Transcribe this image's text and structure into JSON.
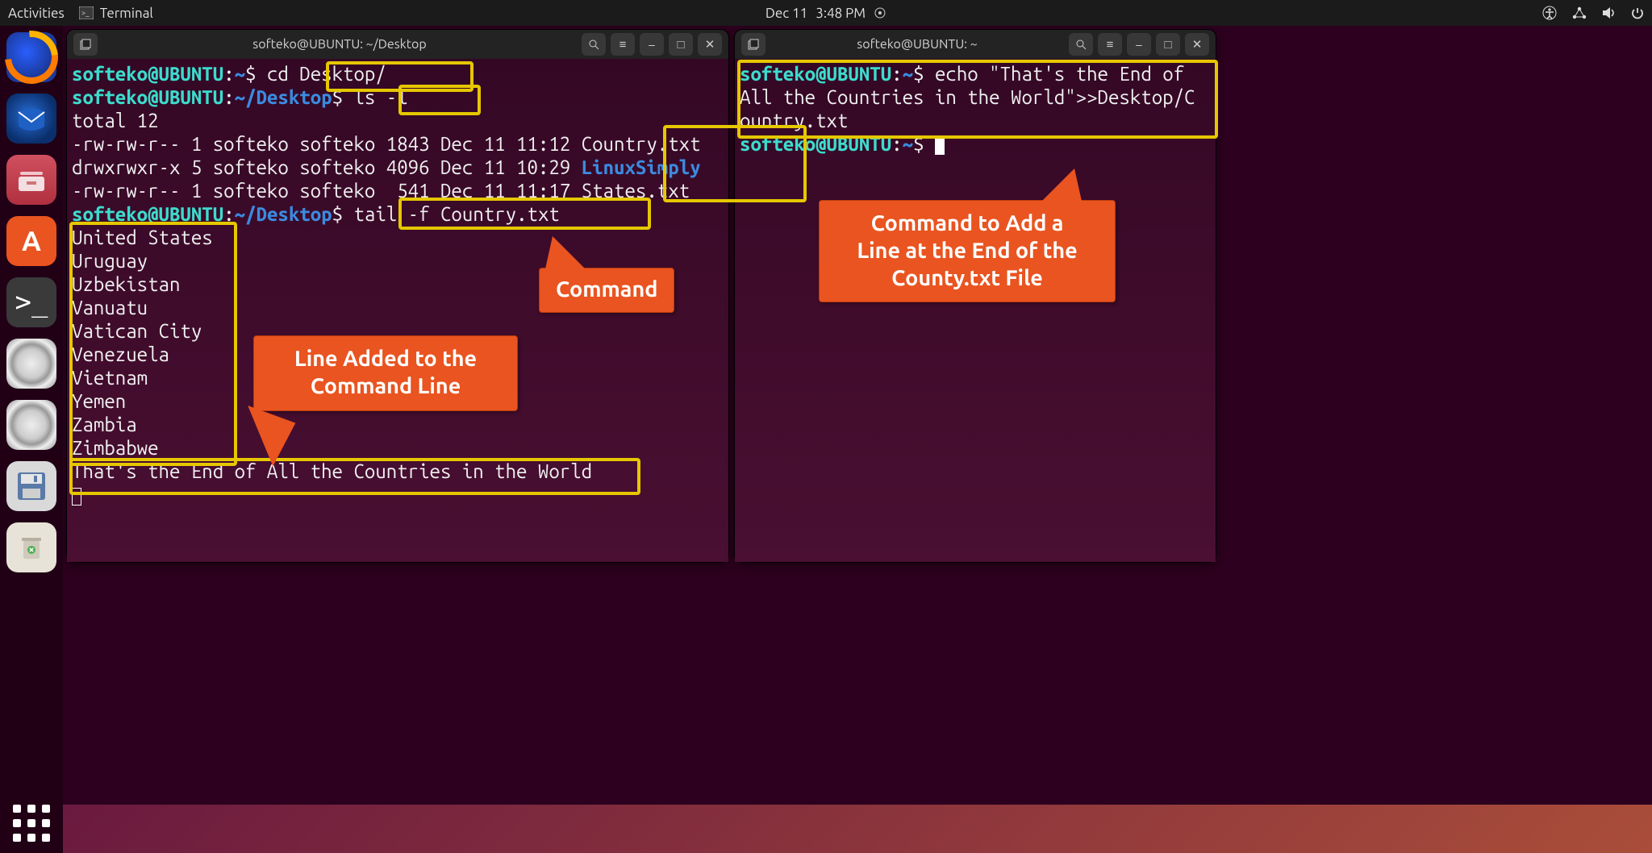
{
  "topbar": {
    "activities": "Activities",
    "app_name": "Terminal",
    "date": "Dec 11",
    "time": "3:48 PM"
  },
  "windows": {
    "left": {
      "title": "softeko@UBUNTU: ~/Desktop",
      "prompt_user": "softeko@UBUNTU",
      "path_home": "~",
      "path_desktop": "~/Desktop",
      "cmd_cd": "cd Desktop/",
      "cmd_ls": "ls -l",
      "total": "total 12",
      "ls_rows": [
        {
          "perm": "-rw-rw-r--",
          "links": "1",
          "owner": "softeko",
          "group": "softeko",
          "size": "1843",
          "date": "Dec 11 11:12",
          "name": "Country.txt",
          "is_dir": false
        },
        {
          "perm": "drwxrwxr-x",
          "links": "5",
          "owner": "softeko",
          "group": "softeko",
          "size": "4096",
          "date": "Dec 11 10:29",
          "name": "LinuxSimply",
          "is_dir": true
        },
        {
          "perm": "-rw-rw-r--",
          "links": "1",
          "owner": "softeko",
          "group": "softeko",
          "size": " 541",
          "date": "Dec 11 11:17",
          "name": "States.txt",
          "is_dir": false
        }
      ],
      "cmd_tail": "tail -f Country.txt",
      "tail_lines": [
        "United States",
        "Uruguay",
        "Uzbekistan",
        "Vanuatu",
        "Vatican City",
        "Venezuela",
        "Vietnam",
        "Yemen",
        "Zambia",
        "Zimbabwe"
      ],
      "appended_line": "That's the End of All the Countries in the World"
    },
    "right": {
      "title": "softeko@UBUNTU: ~",
      "prompt_user": "softeko@UBUNTU",
      "path_home": "~",
      "cmd_echo_1": "echo \"That's the End of",
      "cmd_echo_2": "All the Countries in the World\">>Desktop/C",
      "cmd_echo_3": "ountry.txt"
    }
  },
  "callouts": {
    "command": "Command",
    "line_added": "Line Added to the\nCommand Line",
    "right": "Command to Add a\nLine at the End of the\nCounty.txt File"
  }
}
